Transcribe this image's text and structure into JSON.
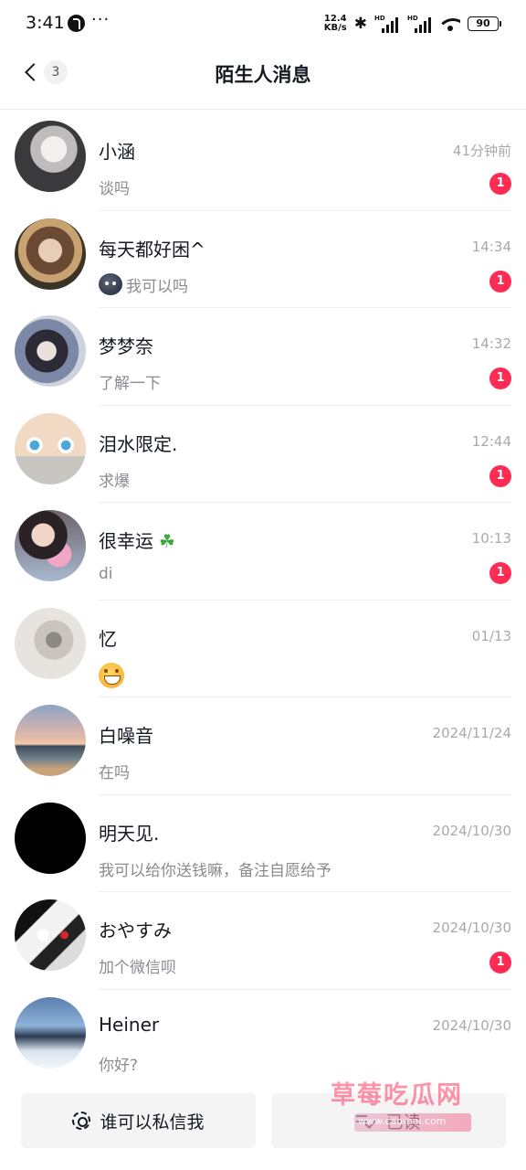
{
  "status_bar": {
    "time": "3:41",
    "dots": "···",
    "net_speed_top": "12.4",
    "net_speed_bottom": "KB/s",
    "signal_label": "HD",
    "battery": "90"
  },
  "header": {
    "back_count": "3",
    "title": "陌生人消息"
  },
  "messages": [
    {
      "name": "小涵",
      "time": "41分钟前",
      "preview": "谈吗",
      "badge": "1"
    },
    {
      "name": "每天都好困^",
      "time": "14:34",
      "preview": "我可以吗",
      "badge": "1",
      "preview_emoji": "dark-blob-emoji"
    },
    {
      "name": "梦梦奈",
      "time": "14:32",
      "preview": "了解一下",
      "badge": "1"
    },
    {
      "name": "泪水限定.",
      "time": "12:44",
      "preview": "求爆",
      "badge": "1"
    },
    {
      "name": "很幸运",
      "time": "10:13",
      "preview": "di",
      "badge": "1",
      "name_emoji": "four-leaf-clover"
    },
    {
      "name": "忆",
      "time": "01/13",
      "preview": "",
      "preview_emoji": "grinning-sweat-emoji"
    },
    {
      "name": "白噪音",
      "time": "2024/11/24",
      "preview": "在吗"
    },
    {
      "name": "明天见.",
      "time": "2024/10/30",
      "preview": "我可以给你送钱嘛，备注自愿给予"
    },
    {
      "name": "おやすみ",
      "time": "2024/10/30",
      "preview": "加个微信呗",
      "badge": "1"
    },
    {
      "name": "Heiner",
      "time": "2024/10/30",
      "preview": "你好?"
    }
  ],
  "bottom": {
    "left_label": "谁可以私信我",
    "right_label": "已读"
  },
  "watermark": {
    "text": "草莓吃瓜网",
    "sub": "www.caomei.com"
  },
  "colors": {
    "badge": "#fe2c55",
    "time_text": "#a8a9ae",
    "preview_text": "#8a8b91"
  }
}
